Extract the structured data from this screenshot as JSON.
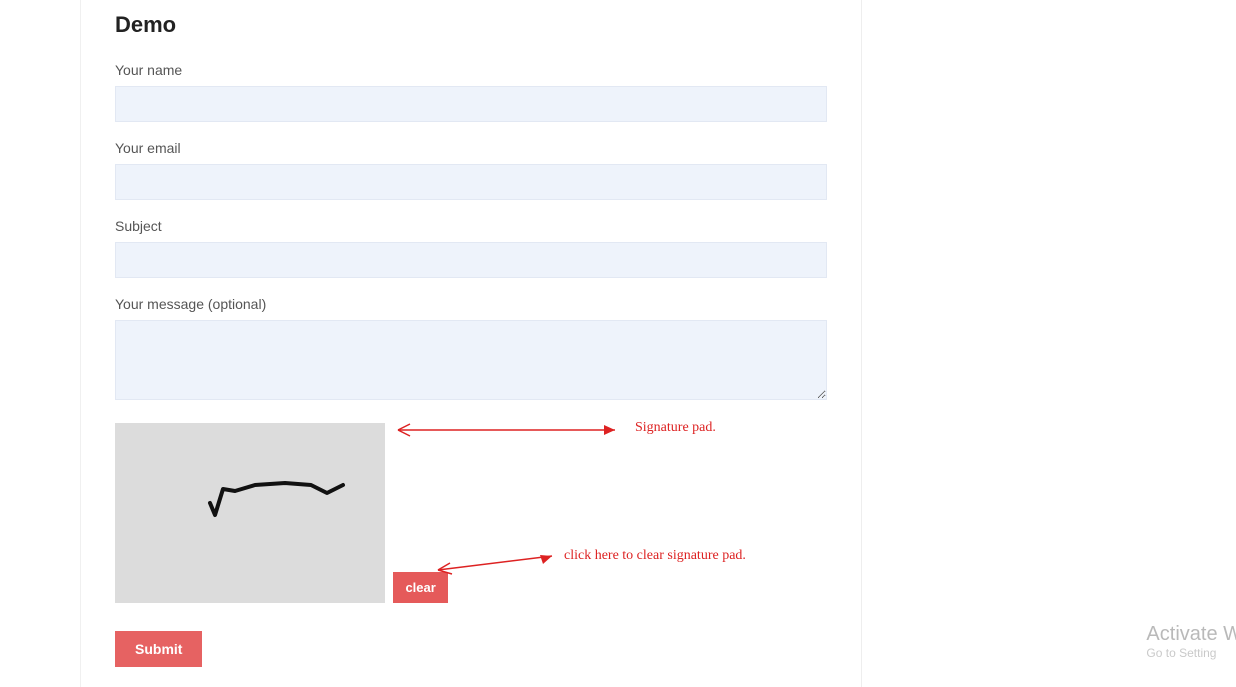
{
  "page": {
    "title": "Demo"
  },
  "form": {
    "name_label": "Your name",
    "name_value": "",
    "email_label": "Your email",
    "email_value": "",
    "subject_label": "Subject",
    "subject_value": "",
    "message_label": "Your message (optional)",
    "message_value": "",
    "clear_label": "clear",
    "submit_label": "Submit"
  },
  "annotations": {
    "sig_pad_label": "Signature pad.",
    "clear_instruction": "click here to clear signature pad."
  },
  "watermark": {
    "title": "Activate W",
    "subtitle": "Go to Setting"
  },
  "colors": {
    "input_bg": "#eef3fb",
    "button_bg": "#e55a5a",
    "sigpad_bg": "#dcdcdc",
    "annotation": "#d22222"
  }
}
